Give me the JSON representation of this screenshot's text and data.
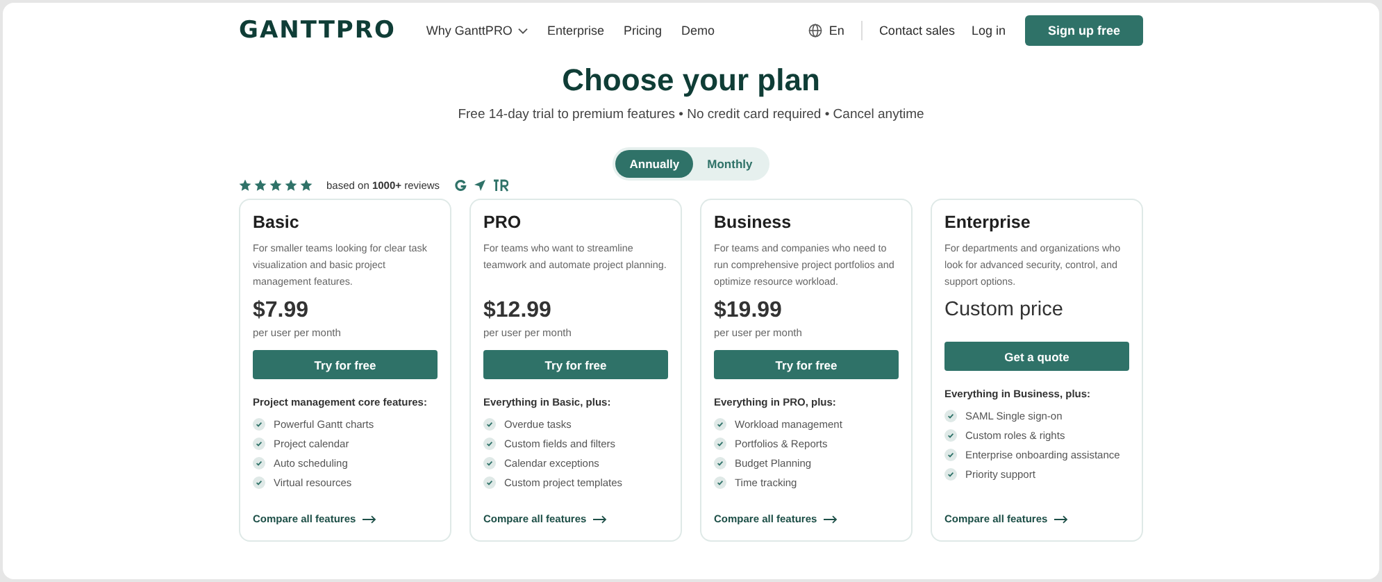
{
  "header": {
    "logo": "GANTTPRO",
    "nav": [
      {
        "label": "Why GanttPRO",
        "dropdown": true
      },
      {
        "label": "Enterprise",
        "dropdown": false
      },
      {
        "label": "Pricing",
        "dropdown": false
      },
      {
        "label": "Demo",
        "dropdown": false
      }
    ],
    "language": "En",
    "links": [
      "Contact sales",
      "Log in"
    ],
    "cta": "Sign up free"
  },
  "hero": {
    "title": "Choose your plan",
    "subtitle": "Free 14-day trial to premium features • No credit card required • Cancel anytime"
  },
  "billing_toggle": [
    {
      "label": "Annually",
      "selected": true
    },
    {
      "label": "Monthly",
      "selected": false
    }
  ],
  "rating": {
    "stars": 5,
    "text": "based on **1000+** reviews"
  },
  "plans": [
    {
      "name": "Basic",
      "description": "For smaller teams looking for clear task visualization and basic project management features.",
      "price": "$7.99",
      "price_note": "per user per month",
      "button": "Try for free",
      "features_title": "Project management core features:",
      "features": [
        "Powerful Gantt charts",
        "Project calendar",
        "Auto scheduling",
        "Virtual resources"
      ],
      "compare": "Compare all features"
    },
    {
      "name": "PRO",
      "description": "For teams who want to streamline teamwork and automate project planning.",
      "price": "$12.99",
      "price_note": "per user per month",
      "button": "Try for free",
      "features_title": "Everything in Basic, plus:",
      "features": [
        "Overdue tasks",
        "Custom fields and filters",
        "Calendar exceptions",
        "Custom project templates"
      ],
      "compare": "Compare all features"
    },
    {
      "name": "Business",
      "description": "For teams and companies who need to run comprehensive project portfolios and optimize resource workload.",
      "price": "$19.99",
      "price_note": "per user per month",
      "button": "Try for free",
      "features_title": "Everything in PRO, plus:",
      "features": [
        "Workload management",
        "Portfolios & Reports",
        "Budget Planning",
        "Time tracking"
      ],
      "compare": "Compare all features"
    },
    {
      "name": "Enterprise",
      "description": "For departments and organizations who look for advanced security, control, and support options.",
      "price": "Custom price",
      "button": "Get a quote",
      "features_title": "Everything in Business, plus:",
      "features": [
        "SAML Single sign-on",
        "Custom roles & rights",
        "Enterprise onboarding assistance",
        "Priority support"
      ],
      "compare": "Compare all features"
    }
  ]
}
